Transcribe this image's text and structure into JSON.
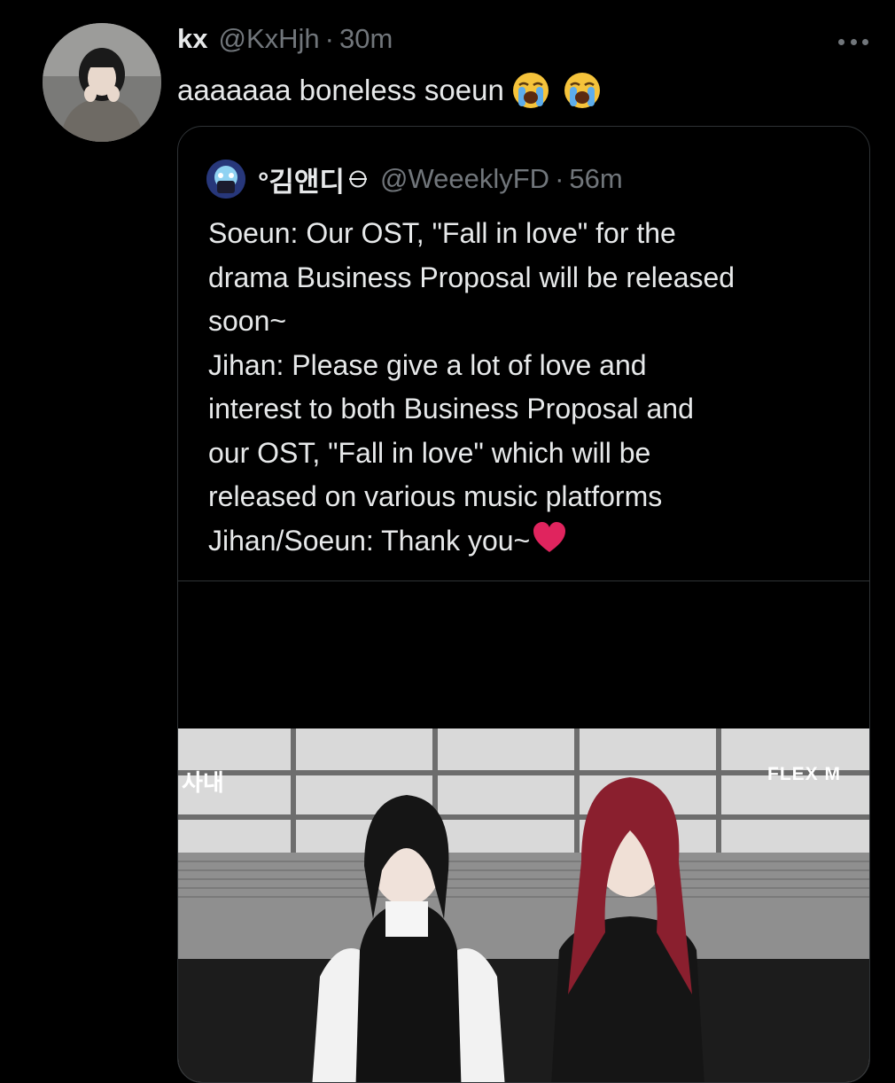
{
  "tweet": {
    "author_name": "kx",
    "author_handle": "@KxHjh",
    "separator": "·",
    "time": "30m",
    "text": "aaaaaaa boneless soeun",
    "emojis": [
      "loudly-crying-face-icon",
      "loudly-crying-face-icon"
    ],
    "more_icon": "more-dots-icon"
  },
  "quoted": {
    "author_name": "°김앤디",
    "author_handle": "@WeeeklyFD",
    "separator": "·",
    "time": "56m",
    "lines": [
      "Soeun: Our OST, \"Fall in love\" for the",
      "drama Business Proposal will be released",
      "soon~",
      "Jihan: Please give a lot of love and",
      "interest to both Business Proposal and",
      "our OST, \"Fall in love\" which will be",
      "released on various music platforms",
      "Jihan/Soeun: Thank you~"
    ],
    "trailing_emoji": "red-heart-icon",
    "media": {
      "watermark": "FLEX M"
    }
  },
  "colors": {
    "background": "#000000",
    "text": "#e7e9ea",
    "secondary": "#71767b",
    "border": "#2f3336"
  }
}
